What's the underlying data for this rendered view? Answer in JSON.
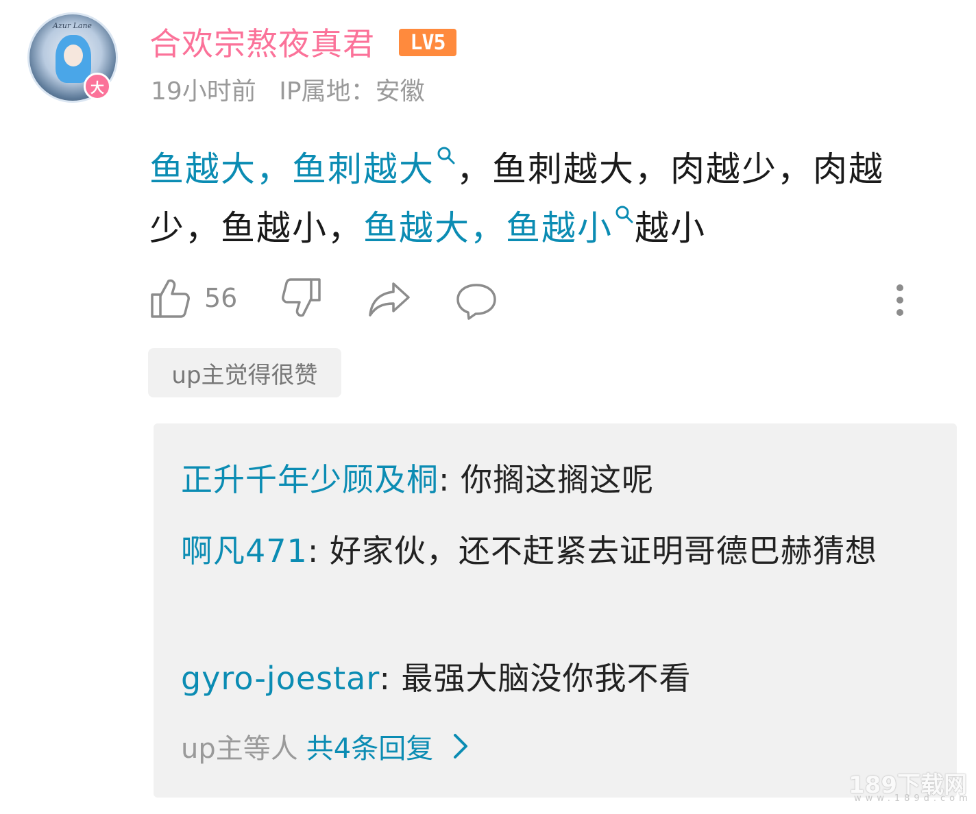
{
  "comment": {
    "username": "合欢宗熬夜真君",
    "level_badge": "LV5",
    "avatar_badge": "大",
    "avatar_ring_text": "Azur Lane",
    "time": "19小时前",
    "ip_location": "IP属地：安徽",
    "text_parts": [
      {
        "text": "鱼越大，鱼刺越大",
        "highlight": true
      },
      {
        "text": "，鱼刺越大，肉越少，肉越少，鱼越小，",
        "highlight": false
      },
      {
        "text": "鱼越大，鱼越小",
        "highlight": true
      },
      {
        "text": "越小",
        "highlight": false
      }
    ],
    "like_count": "56",
    "up_tag": "up主觉得很赞"
  },
  "replies": {
    "items": [
      {
        "author": "正升千年少顾及桐",
        "separator": ":",
        "text": " 你搁这搁这呢"
      },
      {
        "author": "啊凡471",
        "separator": ":",
        "text": " 好家伙，还不赶紧去证明哥德巴赫猜想"
      },
      {
        "author": "gyro-joestar",
        "separator": ":",
        "text": " 最强大脑没你我不看"
      }
    ],
    "more_prefix": "up主等人",
    "more_count": "共4条回复"
  },
  "watermark": {
    "main": "189下载网",
    "sub": "www.189d.com"
  },
  "colors": {
    "username": "#fb7299",
    "highlight": "#0b8cb3",
    "level_badge": "#ff8a3d",
    "meta": "#9a9a9a"
  },
  "icons": [
    "thumbs-up-icon",
    "thumbs-down-icon",
    "share-icon",
    "reply-bubble-icon",
    "more-vertical-icon",
    "search-icon",
    "chevron-right-icon"
  ]
}
